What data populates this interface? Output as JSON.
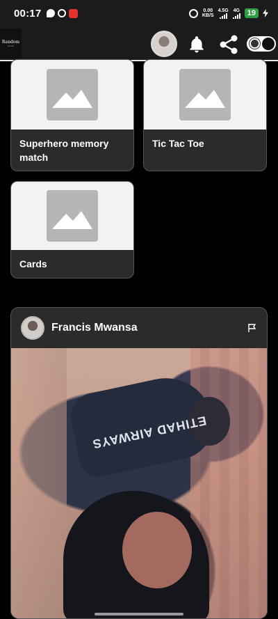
{
  "status_bar": {
    "time": "00:17",
    "net_speed_value": "0.00",
    "net_speed_unit": "KB/S",
    "signal1_label": "4.5G",
    "signal2_label": "4G",
    "battery": "19"
  },
  "header": {
    "logo_text": "Random",
    "logo_subtext": "AI.com"
  },
  "games": [
    {
      "title": "Superhero memory match"
    },
    {
      "title": "Tic Tac Toe"
    },
    {
      "title": "Cards"
    }
  ],
  "post": {
    "author": "Francis Mwansa",
    "image_text": "ETIHAD AIRWAYS"
  },
  "colors": {
    "background": "#000000",
    "card_footer": "#2b2b2b",
    "thumb_bg": "#f2f2f4",
    "placeholder": "#b5b5b5",
    "battery": "#2ea043"
  }
}
